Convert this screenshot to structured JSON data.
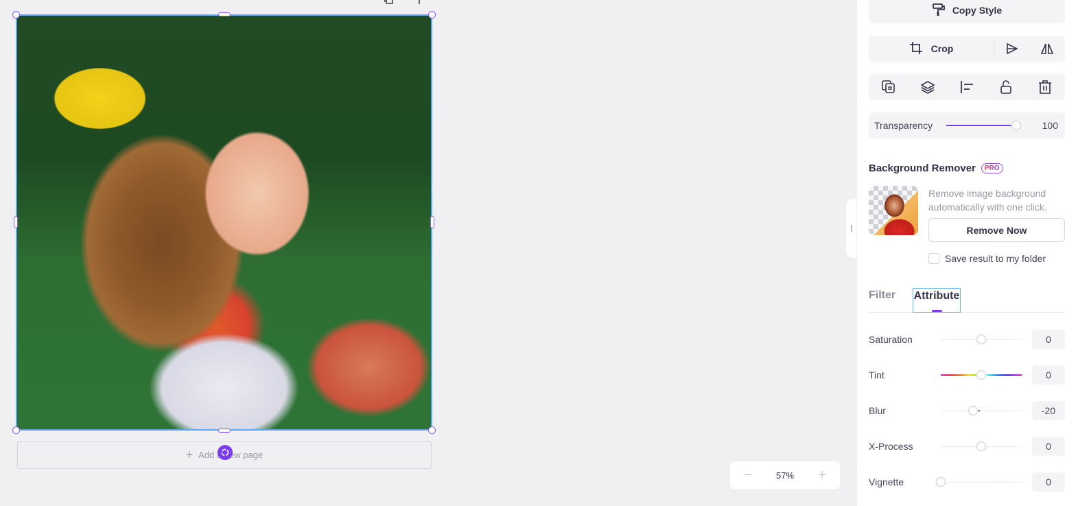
{
  "canvas": {
    "add_page_label": "Add a new page",
    "zoom": {
      "minus_icon": "minus-icon",
      "value": "57%",
      "plus_icon": "plus-icon"
    },
    "photo_alt": "Smiling girl with paint on face and yellow bow"
  },
  "panel": {
    "copy_style_label": "Copy Style",
    "crop_label": "Crop",
    "icons": [
      "duplicate-icon",
      "layers-icon",
      "align-left-icon",
      "unlock-icon",
      "trash-icon"
    ],
    "transparency": {
      "label": "Transparency",
      "value": "100",
      "fraction": 1.0
    },
    "background_remover": {
      "title": "Background Remover",
      "badge": "PRO",
      "description": "Remove image background automatically with one click.",
      "button_label": "Remove Now",
      "checkbox_label": "Save result to my folder",
      "checkbox_checked": false
    },
    "tabs": [
      {
        "label": "Filter",
        "active": false
      },
      {
        "label": "Attribute",
        "active": true
      }
    ],
    "adjustments": [
      {
        "label": "Saturation",
        "value": "0",
        "fraction": 0.5
      },
      {
        "label": "Tint",
        "value": "0",
        "fraction": 0.5
      },
      {
        "label": "Blur",
        "value": "-20",
        "fraction": 0.4
      },
      {
        "label": "X-Process",
        "value": "0",
        "fraction": 0.5
      },
      {
        "label": "Vignette",
        "value": "0",
        "fraction": 0.0
      }
    ],
    "accent_color": "#7a3cf0"
  }
}
